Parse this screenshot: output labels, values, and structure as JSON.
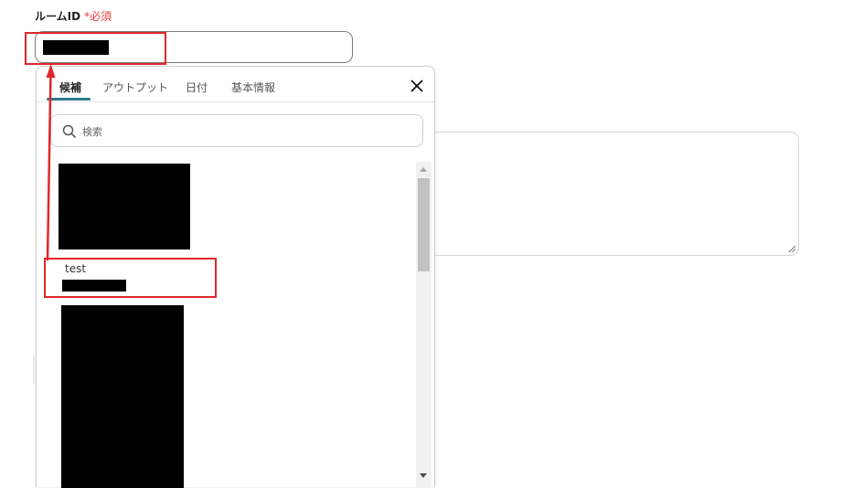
{
  "field": {
    "label": "ルームID",
    "required_marker": "*",
    "required_text": "必須"
  },
  "popup": {
    "tabs": [
      {
        "label": "候補",
        "active": true
      },
      {
        "label": "アウトプット",
        "active": false
      },
      {
        "label": "日付",
        "active": false
      },
      {
        "label": "基本情報",
        "active": false
      }
    ],
    "search": {
      "placeholder": "検索",
      "icon": "search-icon"
    },
    "close_icon": "close-icon",
    "list": {
      "items": [
        {
          "name": "test"
        }
      ]
    }
  },
  "colors": {
    "accent": "#2b7a8c",
    "required": "#e8383d",
    "annotation": "#e02828"
  }
}
